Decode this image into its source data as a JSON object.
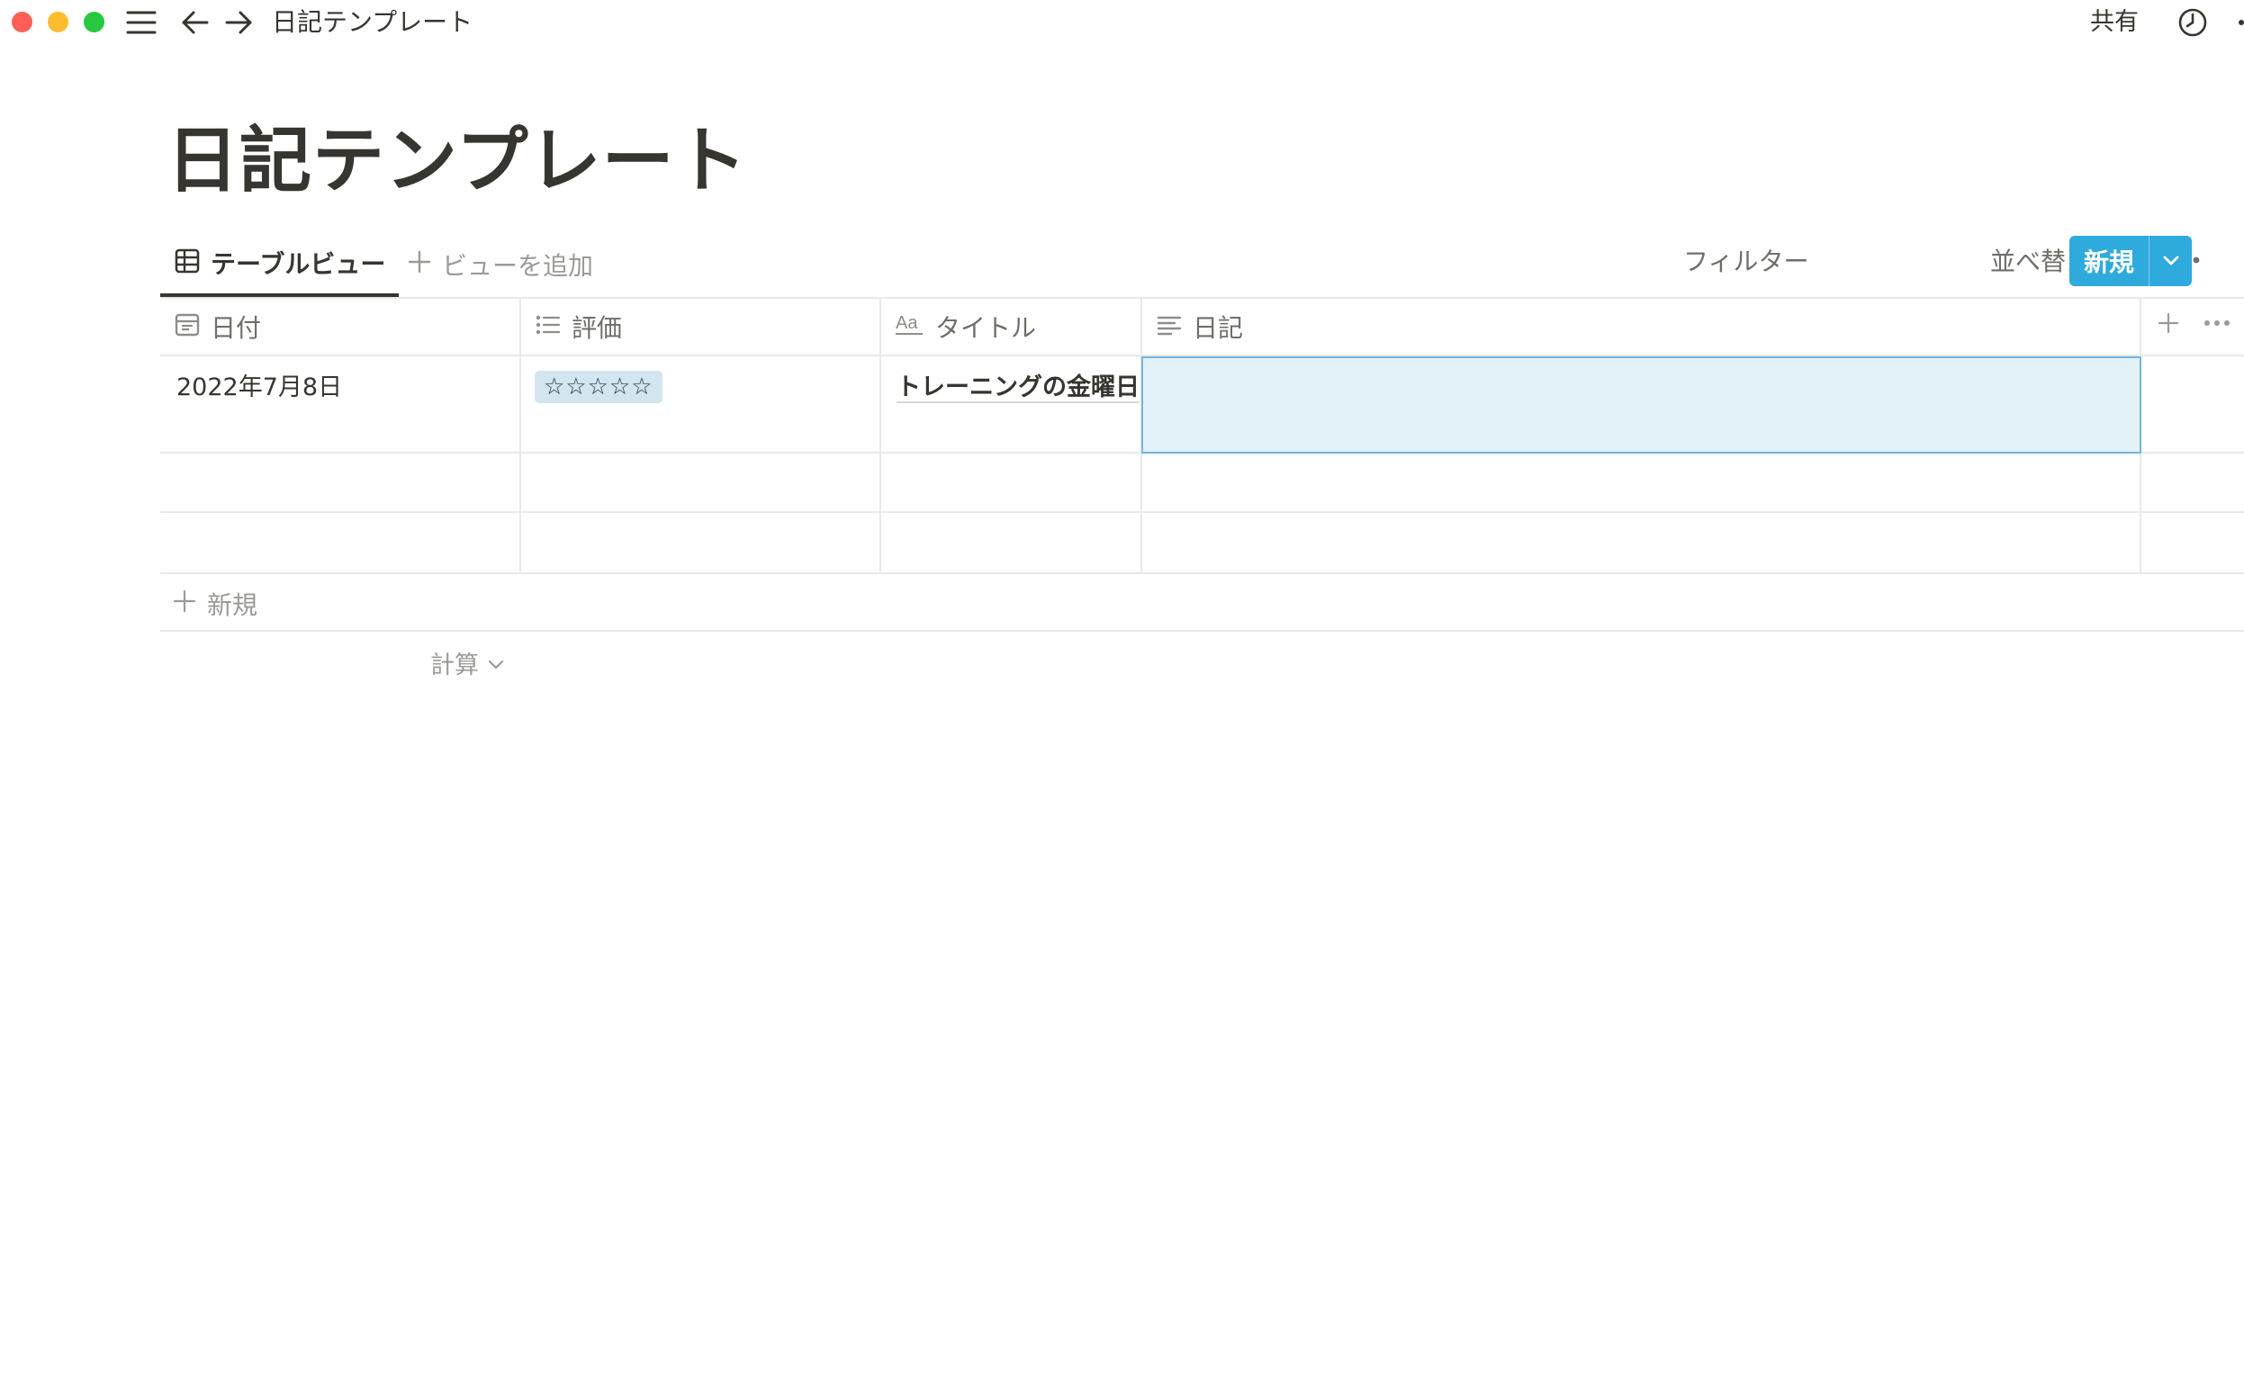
{
  "window": {
    "breadcrumb": "日記テンプレート",
    "share_label": "共有"
  },
  "page": {
    "title": "日記テンプレート"
  },
  "views": {
    "active_tab": "テーブルビュー",
    "add_view_label": "ビューを追加",
    "filter_label": "フィルター",
    "sort_label": "並べ替え",
    "new_button_label": "新規"
  },
  "table": {
    "columns": [
      {
        "label": "日付",
        "icon": "calendar-icon"
      },
      {
        "label": "評価",
        "icon": "list-icon"
      },
      {
        "label": "タイトル",
        "icon": "text-aa-icon"
      },
      {
        "label": "日記",
        "icon": "paragraph-icon"
      }
    ],
    "rows": [
      {
        "date": "2022年7月8日",
        "rating": "☆☆☆☆☆",
        "title": "トレーニングの金曜日",
        "diary": ""
      }
    ],
    "add_row_label": "新規",
    "calculate_label": "計算"
  },
  "colors": {
    "accent": "#2eaadc",
    "selected_cell": "#e3f1f8",
    "rating_tag": "#d3e5ef",
    "text": "#37352f",
    "muted": "#9b9a97"
  }
}
